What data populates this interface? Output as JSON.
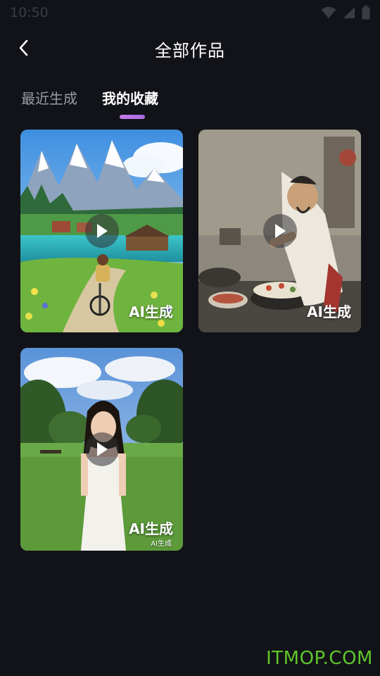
{
  "status_bar": {
    "time": "10:50"
  },
  "header": {
    "title": "全部作品"
  },
  "tabs": [
    {
      "label": "最近生成",
      "active": false
    },
    {
      "label": "我的收藏",
      "active": true
    }
  ],
  "works": [
    {
      "label": "AI生成",
      "scene": "mountain-lake-cyclist"
    },
    {
      "label": "AI生成",
      "scene": "ink-chef-cooking"
    },
    {
      "label": "AI生成",
      "sub_label": "AI生成",
      "scene": "girl-white-dress-park"
    }
  ],
  "watermark": "ITMOP.COM",
  "colors": {
    "background": "#121318",
    "accent": "#c77bea",
    "watermark": "#5fc62a"
  }
}
